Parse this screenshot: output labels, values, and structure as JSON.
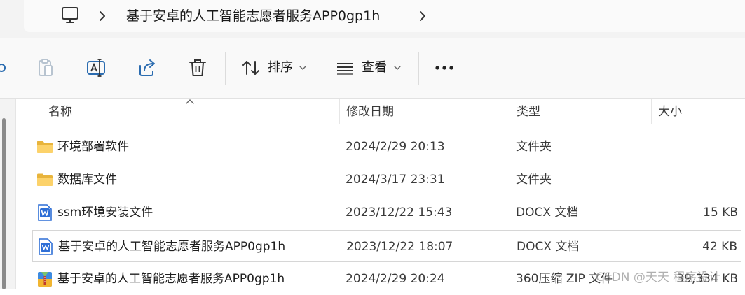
{
  "address_bar": {
    "root_icon": "computer-icon",
    "current_folder": "基于安卓的人工智能志愿者服务APP0gp1h"
  },
  "toolbar": {
    "icons": [
      "cut-icon",
      "paste-icon",
      "rename-icon",
      "share-icon",
      "delete-icon"
    ],
    "sort_label": "排序",
    "view_label": "查看",
    "more_icon": "more-horizontal-icon"
  },
  "columns": {
    "name": "名称",
    "modified": "修改日期",
    "type": "类型",
    "size": "大小"
  },
  "files": [
    {
      "icon": "folder-icon",
      "name": "环境部署软件",
      "modified": "2024/2/29 20:13",
      "type": "文件夹",
      "size": ""
    },
    {
      "icon": "folder-icon",
      "name": "数据库文件",
      "modified": "2024/3/17 23:31",
      "type": "文件夹",
      "size": ""
    },
    {
      "icon": "word-doc-icon",
      "name": "ssm环境安装文件",
      "modified": "2023/12/22 15:43",
      "type": "DOCX 文档",
      "size": "15 KB"
    },
    {
      "icon": "word-doc-icon",
      "name": "基于安卓的人工智能志愿者服务APP0gp1h",
      "modified": "2023/12/22 18:07",
      "type": "DOCX 文档",
      "size": "42 KB"
    },
    {
      "icon": "zip-archive-icon",
      "name": "基于安卓的人工智能志愿者服务APP0gp1h",
      "modified": "2024/2/29 20:24",
      "type": "360压缩 ZIP 文件",
      "size": "39,334 KB"
    }
  ],
  "watermark": "CSDN @天天 程序设计"
}
